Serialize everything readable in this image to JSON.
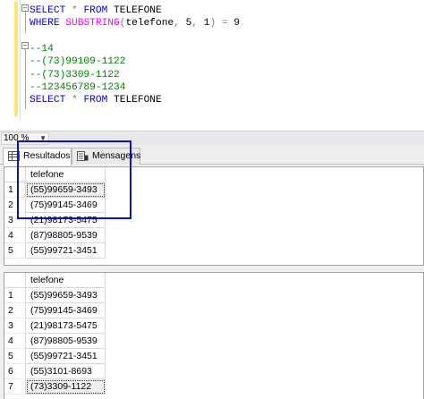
{
  "editor": {
    "lines": [
      {
        "parts": [
          [
            "kw",
            "SELECT "
          ],
          [
            "op",
            "* "
          ],
          [
            "kw",
            "FROM "
          ],
          [
            "tx",
            "TELEFONE"
          ]
        ]
      },
      {
        "parts": [
          [
            "kw",
            "WHERE "
          ],
          [
            "fn",
            "SUBSTRING"
          ],
          [
            "op",
            "("
          ],
          [
            "tx",
            "telefone"
          ],
          [
            "op",
            ", "
          ],
          [
            "tx",
            "5"
          ],
          [
            "op",
            ", "
          ],
          [
            "tx",
            "1"
          ],
          [
            "op",
            ") = "
          ],
          [
            "tx",
            "9"
          ]
        ]
      },
      {
        "parts": []
      },
      {
        "parts": [
          [
            "cm",
            "--14"
          ]
        ]
      },
      {
        "parts": [
          [
            "cm",
            "--(73)99109-1122"
          ]
        ]
      },
      {
        "parts": [
          [
            "cm",
            "--(73)3309-1122"
          ]
        ]
      },
      {
        "parts": [
          [
            "cm",
            "--123456789-1234"
          ]
        ]
      },
      {
        "parts": [
          [
            "kw",
            "SELECT "
          ],
          [
            "op",
            "* "
          ],
          [
            "kw",
            "FROM "
          ],
          [
            "tx",
            "TELEFONE"
          ]
        ]
      }
    ]
  },
  "zoom": {
    "value": "100 %"
  },
  "tabs": {
    "results_label": "Resultados",
    "messages_label": "Mensagens"
  },
  "grid1": {
    "column": "telefone",
    "rows": [
      {
        "n": "1",
        "v": "(55)99659-3493"
      },
      {
        "n": "2",
        "v": "(75)99145-3469"
      },
      {
        "n": "3",
        "v": "(21)98173-5475"
      },
      {
        "n": "4",
        "v": "(87)98805-9539"
      },
      {
        "n": "5",
        "v": "(55)99721-3451"
      }
    ]
  },
  "grid2": {
    "column": "telefone",
    "rows": [
      {
        "n": "1",
        "v": "(55)99659-3493"
      },
      {
        "n": "2",
        "v": "(75)99145-3469"
      },
      {
        "n": "3",
        "v": "(21)98173-5475"
      },
      {
        "n": "4",
        "v": "(87)98805-9539"
      },
      {
        "n": "5",
        "v": "(55)99721-3451"
      },
      {
        "n": "6",
        "v": "(55)3101-8693"
      },
      {
        "n": "7",
        "v": "(73)3309-1122"
      }
    ]
  },
  "colors": {
    "highlight_border": "#0a10c8",
    "keyword": "#0000ff",
    "function": "#ff00ff",
    "comment": "#008000"
  }
}
